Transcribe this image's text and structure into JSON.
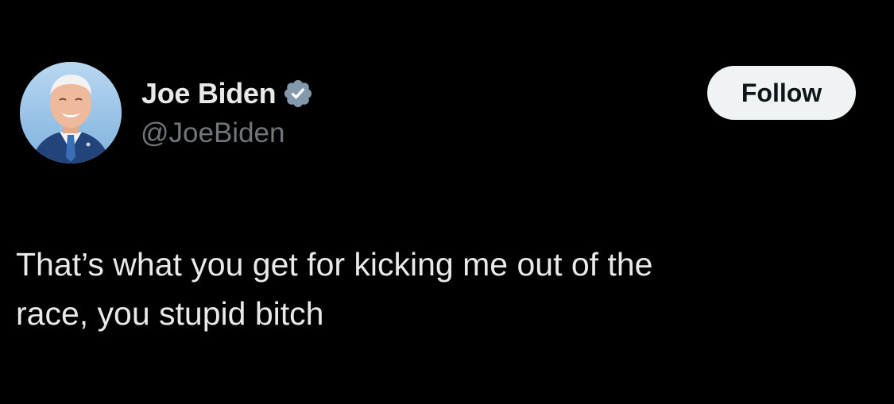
{
  "tweet": {
    "author": {
      "display_name": "Joe Biden",
      "handle": "@JoeBiden",
      "verified": true,
      "verified_icon": "verified-badge-icon",
      "avatar": "profile-photo"
    },
    "follow_label": "Follow",
    "text": "That’s what you get for kicking me out of the\nrace, you stupid bitch"
  },
  "colors": {
    "background": "#000000",
    "text_primary": "#e7e9ea",
    "text_secondary": "#71767b",
    "button_bg": "#eff3f4",
    "button_text": "#0f1419",
    "badge": "#829aab"
  }
}
